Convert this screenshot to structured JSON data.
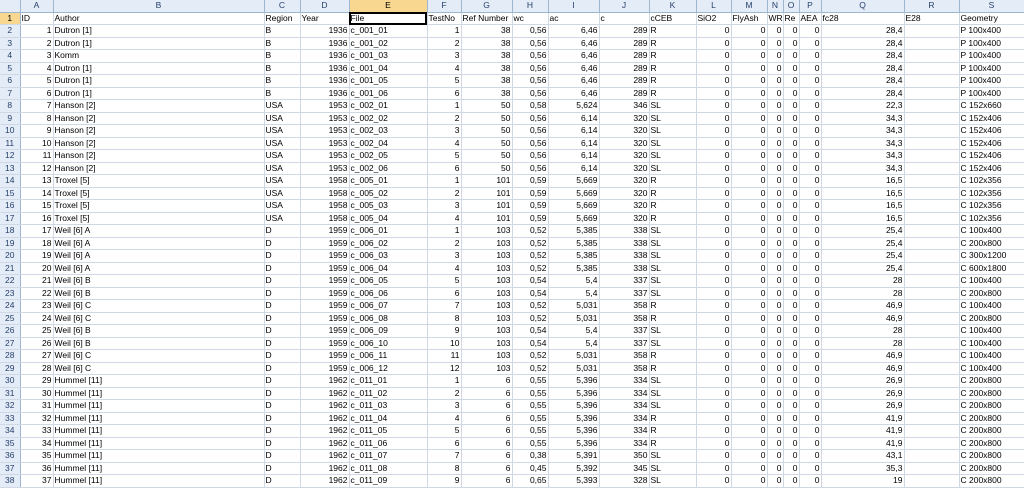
{
  "columns": [
    "A",
    "B",
    "C",
    "D",
    "E",
    "F",
    "G",
    "H",
    "I",
    "J",
    "K",
    "L",
    "M",
    "N",
    "O",
    "P",
    "Q",
    "R",
    "S"
  ],
  "selected_column": "E",
  "selected_row": 1,
  "headers": [
    "ID",
    "Author",
    "Region",
    "Year",
    "File",
    "TestNo",
    "Ref Number",
    "wc",
    "ac",
    "c",
    "cCEB",
    "SiO2",
    "FlyAsh",
    "WR",
    "Re",
    "AEA",
    "fc28",
    "E28",
    "Geometry"
  ],
  "rows": [
    [
      "1",
      "Dutron [1]",
      "B",
      "1936",
      "c_001_01",
      "1",
      "38",
      "0,56",
      "6,46",
      "289",
      "R",
      "0",
      "0",
      "0",
      "0",
      "0",
      "28,4",
      "",
      "P 100x400"
    ],
    [
      "2",
      "Dutron [1]",
      "B",
      "1936",
      "c_001_02",
      "2",
      "38",
      "0,56",
      "6,46",
      "289",
      "R",
      "0",
      "0",
      "0",
      "0",
      "0",
      "28,4",
      "",
      "P 100x400"
    ],
    [
      "3",
      "Komm",
      "B",
      "1936",
      "c_001_03",
      "3",
      "38",
      "0,56",
      "6,46",
      "289",
      "R",
      "0",
      "0",
      "0",
      "0",
      "0",
      "28,4",
      "",
      "P 100x400"
    ],
    [
      "4",
      "Dutron [1]",
      "B",
      "1936",
      "c_001_04",
      "4",
      "38",
      "0,56",
      "6,46",
      "289",
      "R",
      "0",
      "0",
      "0",
      "0",
      "0",
      "28,4",
      "",
      "P 100x400"
    ],
    [
      "5",
      "Dutron [1]",
      "B",
      "1936",
      "c_001_05",
      "5",
      "38",
      "0,56",
      "6,46",
      "289",
      "R",
      "0",
      "0",
      "0",
      "0",
      "0",
      "28,4",
      "",
      "P 100x400"
    ],
    [
      "6",
      "Dutron [1]",
      "B",
      "1936",
      "c_001_06",
      "6",
      "38",
      "0,56",
      "6,46",
      "289",
      "R",
      "0",
      "0",
      "0",
      "0",
      "0",
      "28,4",
      "",
      "P 100x400"
    ],
    [
      "7",
      "Hanson [2]",
      "USA",
      "1953",
      "c_002_01",
      "1",
      "50",
      "0,58",
      "5,624",
      "346",
      "SL",
      "0",
      "0",
      "0",
      "0",
      "0",
      "22,3",
      "",
      "C 152x660"
    ],
    [
      "8",
      "Hanson [2]",
      "USA",
      "1953",
      "c_002_02",
      "2",
      "50",
      "0,56",
      "6,14",
      "320",
      "SL",
      "0",
      "0",
      "0",
      "0",
      "0",
      "34,3",
      "",
      "C 152x406"
    ],
    [
      "9",
      "Hanson [2]",
      "USA",
      "1953",
      "c_002_03",
      "3",
      "50",
      "0,56",
      "6,14",
      "320",
      "SL",
      "0",
      "0",
      "0",
      "0",
      "0",
      "34,3",
      "",
      "C 152x406"
    ],
    [
      "10",
      "Hanson [2]",
      "USA",
      "1953",
      "c_002_04",
      "4",
      "50",
      "0,56",
      "6,14",
      "320",
      "SL",
      "0",
      "0",
      "0",
      "0",
      "0",
      "34,3",
      "",
      "C 152x406"
    ],
    [
      "11",
      "Hanson [2]",
      "USA",
      "1953",
      "c_002_05",
      "5",
      "50",
      "0,56",
      "6,14",
      "320",
      "SL",
      "0",
      "0",
      "0",
      "0",
      "0",
      "34,3",
      "",
      "C 152x406"
    ],
    [
      "12",
      "Hanson [2]",
      "USA",
      "1953",
      "c_002_06",
      "6",
      "50",
      "0,56",
      "6,14",
      "320",
      "SL",
      "0",
      "0",
      "0",
      "0",
      "0",
      "34,3",
      "",
      "C 152x406"
    ],
    [
      "13",
      "Troxel [5]",
      "USA",
      "1958",
      "c_005_01",
      "1",
      "101",
      "0,59",
      "5,669",
      "320",
      "R",
      "0",
      "0",
      "0",
      "0",
      "0",
      "16,5",
      "",
      "C 102x356"
    ],
    [
      "14",
      "Troxel [5]",
      "USA",
      "1958",
      "c_005_02",
      "2",
      "101",
      "0,59",
      "5,669",
      "320",
      "R",
      "0",
      "0",
      "0",
      "0",
      "0",
      "16,5",
      "",
      "C 102x356"
    ],
    [
      "15",
      "Troxel [5]",
      "USA",
      "1958",
      "c_005_03",
      "3",
      "101",
      "0,59",
      "5,669",
      "320",
      "R",
      "0",
      "0",
      "0",
      "0",
      "0",
      "16,5",
      "",
      "C 102x356"
    ],
    [
      "16",
      "Troxel [5]",
      "USA",
      "1958",
      "c_005_04",
      "4",
      "101",
      "0,59",
      "5,669",
      "320",
      "R",
      "0",
      "0",
      "0",
      "0",
      "0",
      "16,5",
      "",
      "C 102x356"
    ],
    [
      "17",
      "Weil [6] A",
      "D",
      "1959",
      "c_006_01",
      "1",
      "103",
      "0,52",
      "5,385",
      "338",
      "SL",
      "0",
      "0",
      "0",
      "0",
      "0",
      "25,4",
      "",
      "C 100x400"
    ],
    [
      "18",
      "Weil [6] A",
      "D",
      "1959",
      "c_006_02",
      "2",
      "103",
      "0,52",
      "5,385",
      "338",
      "SL",
      "0",
      "0",
      "0",
      "0",
      "0",
      "25,4",
      "",
      "C 200x800"
    ],
    [
      "19",
      "Weil [6] A",
      "D",
      "1959",
      "c_006_03",
      "3",
      "103",
      "0,52",
      "5,385",
      "338",
      "SL",
      "0",
      "0",
      "0",
      "0",
      "0",
      "25,4",
      "",
      "C 300x1200"
    ],
    [
      "20",
      "Weil [6] A",
      "D",
      "1959",
      "c_006_04",
      "4",
      "103",
      "0,52",
      "5,385",
      "338",
      "SL",
      "0",
      "0",
      "0",
      "0",
      "0",
      "25,4",
      "",
      "C 600x1800"
    ],
    [
      "21",
      "Weil [6] B",
      "D",
      "1959",
      "c_006_05",
      "5",
      "103",
      "0,54",
      "5,4",
      "337",
      "SL",
      "0",
      "0",
      "0",
      "0",
      "0",
      "28",
      "",
      "C 100x400"
    ],
    [
      "22",
      "Weil [6] B",
      "D",
      "1959",
      "c_006_06",
      "6",
      "103",
      "0,54",
      "5,4",
      "337",
      "SL",
      "0",
      "0",
      "0",
      "0",
      "0",
      "28",
      "",
      "C 200x800"
    ],
    [
      "23",
      "Weil [6] C",
      "D",
      "1959",
      "c_006_07",
      "7",
      "103",
      "0,52",
      "5,031",
      "358",
      "R",
      "0",
      "0",
      "0",
      "0",
      "0",
      "46,9",
      "",
      "C 100x400"
    ],
    [
      "24",
      "Weil [6] C",
      "D",
      "1959",
      "c_006_08",
      "8",
      "103",
      "0,52",
      "5,031",
      "358",
      "R",
      "0",
      "0",
      "0",
      "0",
      "0",
      "46,9",
      "",
      "C 200x800"
    ],
    [
      "25",
      "Weil [6] B",
      "D",
      "1959",
      "c_006_09",
      "9",
      "103",
      "0,54",
      "5,4",
      "337",
      "SL",
      "0",
      "0",
      "0",
      "0",
      "0",
      "28",
      "",
      "C 100x400"
    ],
    [
      "26",
      "Weil [6] B",
      "D",
      "1959",
      "c_006_10",
      "10",
      "103",
      "0,54",
      "5,4",
      "337",
      "SL",
      "0",
      "0",
      "0",
      "0",
      "0",
      "28",
      "",
      "C 100x400"
    ],
    [
      "27",
      "Weil [6] C",
      "D",
      "1959",
      "c_006_11",
      "11",
      "103",
      "0,52",
      "5,031",
      "358",
      "R",
      "0",
      "0",
      "0",
      "0",
      "0",
      "46,9",
      "",
      "C 100x400"
    ],
    [
      "28",
      "Weil [6] C",
      "D",
      "1959",
      "c_006_12",
      "12",
      "103",
      "0,52",
      "5,031",
      "358",
      "R",
      "0",
      "0",
      "0",
      "0",
      "0",
      "46,9",
      "",
      "C 100x400"
    ],
    [
      "29",
      "Hummel [11]",
      "D",
      "1962",
      "c_011_01",
      "1",
      "6",
      "0,55",
      "5,396",
      "334",
      "SL",
      "0",
      "0",
      "0",
      "0",
      "0",
      "26,9",
      "",
      "C 200x800"
    ],
    [
      "30",
      "Hummel [11]",
      "D",
      "1962",
      "c_011_02",
      "2",
      "6",
      "0,55",
      "5,396",
      "334",
      "SL",
      "0",
      "0",
      "0",
      "0",
      "0",
      "26,9",
      "",
      "C 200x800"
    ],
    [
      "31",
      "Hummel [11]",
      "D",
      "1962",
      "c_011_03",
      "3",
      "6",
      "0,55",
      "5,396",
      "334",
      "SL",
      "0",
      "0",
      "0",
      "0",
      "0",
      "26,9",
      "",
      "C 200x800"
    ],
    [
      "32",
      "Hummel [11]",
      "D",
      "1962",
      "c_011_04",
      "4",
      "6",
      "0,55",
      "5,396",
      "334",
      "R",
      "0",
      "0",
      "0",
      "0",
      "0",
      "41,9",
      "",
      "C 200x800"
    ],
    [
      "33",
      "Hummel [11]",
      "D",
      "1962",
      "c_011_05",
      "5",
      "6",
      "0,55",
      "5,396",
      "334",
      "R",
      "0",
      "0",
      "0",
      "0",
      "0",
      "41,9",
      "",
      "C 200x800"
    ],
    [
      "34",
      "Hummel [11]",
      "D",
      "1962",
      "c_011_06",
      "6",
      "6",
      "0,55",
      "5,396",
      "334",
      "R",
      "0",
      "0",
      "0",
      "0",
      "0",
      "41,9",
      "",
      "C 200x800"
    ],
    [
      "35",
      "Hummel [11]",
      "D",
      "1962",
      "c_011_07",
      "7",
      "6",
      "0,38",
      "5,391",
      "350",
      "SL",
      "0",
      "0",
      "0",
      "0",
      "0",
      "43,1",
      "",
      "C 200x800"
    ],
    [
      "36",
      "Hummel [11]",
      "D",
      "1962",
      "c_011_08",
      "8",
      "6",
      "0,45",
      "5,392",
      "345",
      "SL",
      "0",
      "0",
      "0",
      "0",
      "0",
      "35,3",
      "",
      "C 200x800"
    ],
    [
      "37",
      "Hummel [11]",
      "D",
      "1962",
      "c_011_09",
      "9",
      "6",
      "0,65",
      "5,393",
      "328",
      "SL",
      "0",
      "0",
      "0",
      "0",
      "0",
      "19",
      "",
      "C 200x800"
    ]
  ]
}
